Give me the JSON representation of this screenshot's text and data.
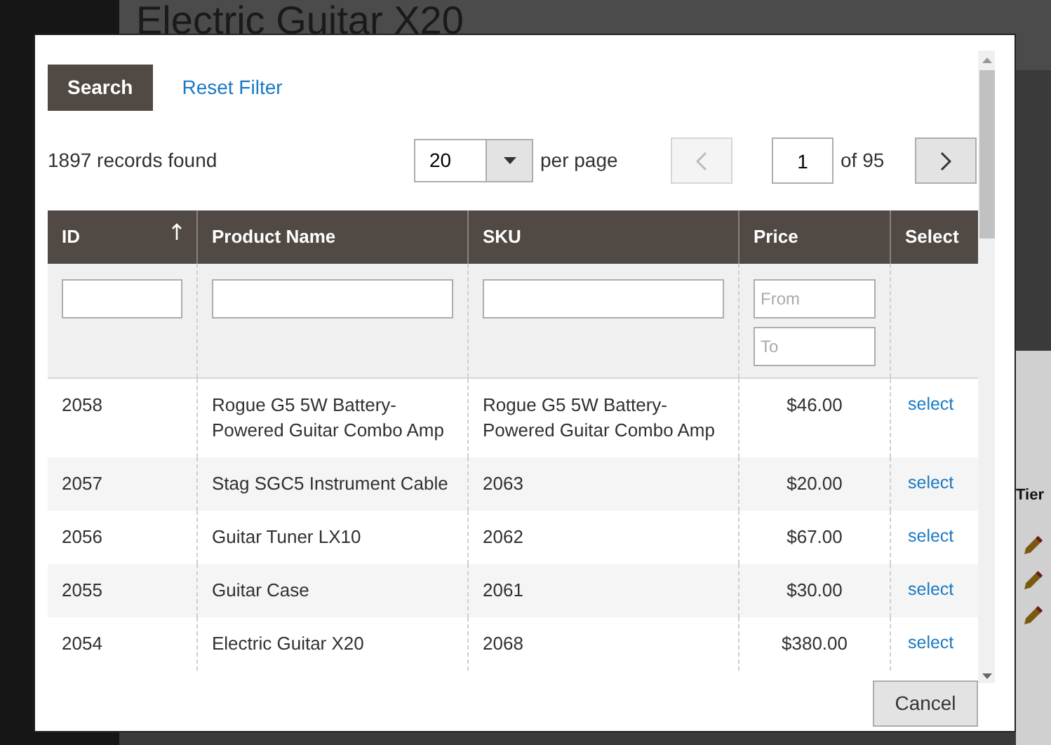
{
  "page": {
    "title": "Electric Guitar X20",
    "side_label": "Tier"
  },
  "modal": {
    "search_button": "Search",
    "reset_link": "Reset Filter",
    "records": "1897 records found",
    "per_page": {
      "value": "20",
      "label": "per page"
    },
    "pager": {
      "page": "1",
      "of": "of 95",
      "prev_disabled": true,
      "next_disabled": false
    },
    "columns": [
      {
        "label": "ID",
        "sorted": true,
        "kind": "text"
      },
      {
        "label": "Product Name",
        "sorted": false,
        "kind": "text"
      },
      {
        "label": "SKU",
        "sorted": false,
        "kind": "text"
      },
      {
        "label": "Price",
        "sorted": false,
        "kind": "range",
        "from_placeholder": "From",
        "to_placeholder": "To"
      },
      {
        "label": "Select",
        "sorted": false,
        "kind": "action"
      }
    ],
    "rows": [
      {
        "cells": [
          "2058",
          "Rogue G5 5W Battery-Powered Guitar Combo Amp",
          "Rogue G5 5W Battery-Powered Guitar Combo Amp",
          "$46.00"
        ],
        "action": "select"
      },
      {
        "cells": [
          "2057",
          "Stag SGC5 Instrument Cable",
          "2063",
          "$20.00"
        ],
        "action": "select"
      },
      {
        "cells": [
          "2056",
          "Guitar Tuner LX10",
          "2062",
          "$67.00"
        ],
        "action": "select"
      },
      {
        "cells": [
          "2055",
          "Guitar Case",
          "2061",
          "$30.00"
        ],
        "action": "select"
      },
      {
        "cells": [
          "2054",
          "Electric Guitar X20",
          "2068",
          "$380.00"
        ],
        "action": "select"
      }
    ],
    "cancel_button": "Cancel"
  }
}
